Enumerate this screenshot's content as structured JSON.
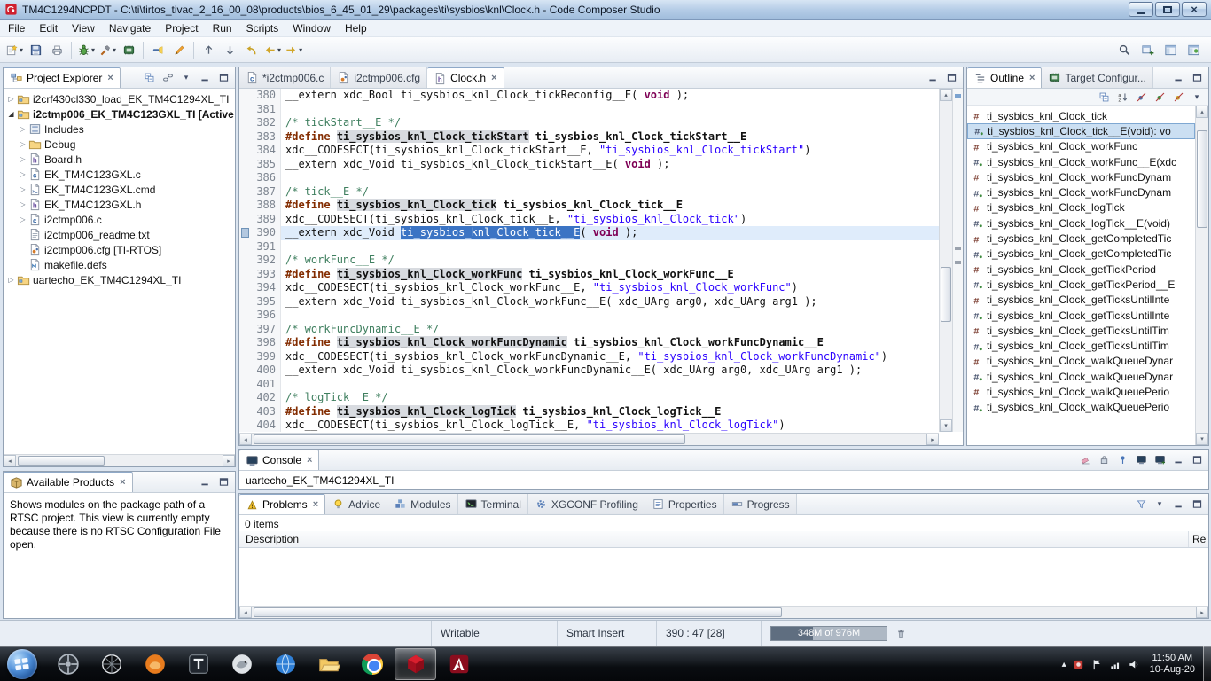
{
  "titlebar": {
    "title": "TM4C1294NCPDT - C:\\ti\\tirtos_tivac_2_16_00_08\\products\\bios_6_45_01_29\\packages\\ti\\sysbios\\knl\\Clock.h - Code Composer Studio",
    "app_icon": "app-ccs"
  },
  "menubar": {
    "items": [
      "File",
      "Edit",
      "View",
      "Navigate",
      "Project",
      "Run",
      "Scripts",
      "Window",
      "Help"
    ]
  },
  "toolbar": {
    "groups": [
      [
        {
          "name": "new-wizard",
          "icon": "new-wizard",
          "dropdown": true
        },
        {
          "name": "save",
          "icon": "save"
        },
        {
          "name": "print",
          "icon": "print"
        }
      ],
      [
        {
          "name": "debug",
          "icon": "debug",
          "dropdown": true
        },
        {
          "name": "build",
          "icon": "build",
          "dropdown": true
        },
        {
          "name": "new-target-config",
          "icon": "target-config"
        }
      ],
      [
        {
          "name": "flash",
          "icon": "flashlight"
        },
        {
          "name": "edit",
          "icon": "pencil"
        }
      ],
      [
        {
          "name": "prev-annotation",
          "icon": "arrow-up"
        },
        {
          "name": "next-annotation",
          "icon": "arrow-down"
        },
        {
          "name": "last-edit-location",
          "icon": "last-edit"
        },
        {
          "name": "back",
          "icon": "nav-back",
          "dropdown": true
        },
        {
          "name": "forward",
          "icon": "nav-forward",
          "dropdown": true
        }
      ]
    ],
    "right": [
      {
        "name": "search",
        "icon": "search"
      },
      {
        "name": "open-perspective",
        "icon": "open-perspective"
      },
      {
        "name": "ccs-edit-perspective",
        "icon": "perspective-edit"
      },
      {
        "name": "ccs-debug-perspective",
        "icon": "perspective-debug"
      }
    ]
  },
  "project_explorer": {
    "tabs": [
      {
        "label": "Project Explorer",
        "icon": "explorer-view",
        "active": true,
        "close": true
      }
    ],
    "toolbar": [
      "collapse-all",
      "link-editor",
      "view-menu",
      "minimize-view",
      "maximize-view"
    ],
    "tree": [
      {
        "label": "i2crf430cl330_load_EK_TM4C1294XL_TI",
        "depth": 0,
        "arrow": "collapsed",
        "icon": "project",
        "bold": false
      },
      {
        "label": "i2ctmp006_EK_TM4C123GXL_TI [Active",
        "depth": 0,
        "arrow": "expanded",
        "icon": "project",
        "bold": true
      },
      {
        "label": "Includes",
        "depth": 1,
        "arrow": "collapsed",
        "icon": "includes",
        "bold": false
      },
      {
        "label": "Debug",
        "depth": 1,
        "arrow": "collapsed",
        "icon": "folder",
        "bold": false
      },
      {
        "label": "Board.h",
        "depth": 1,
        "arrow": "collapsed",
        "icon": "h-file",
        "bold": false
      },
      {
        "label": "EK_TM4C123GXL.c",
        "depth": 1,
        "arrow": "collapsed",
        "icon": "c-file",
        "bold": false
      },
      {
        "label": "EK_TM4C123GXL.cmd",
        "depth": 1,
        "arrow": "collapsed",
        "icon": "cmd-file",
        "bold": false
      },
      {
        "label": "EK_TM4C123GXL.h",
        "depth": 1,
        "arrow": "collapsed",
        "icon": "h-file",
        "bold": false
      },
      {
        "label": "i2ctmp006.c",
        "depth": 1,
        "arrow": "collapsed",
        "icon": "c-file",
        "bold": false
      },
      {
        "label": "i2ctmp006_readme.txt",
        "depth": 1,
        "arrow": "none",
        "icon": "txt-file",
        "bold": false
      },
      {
        "label": "i2ctmp006.cfg [TI-RTOS]",
        "depth": 1,
        "arrow": "none",
        "icon": "cfg-file",
        "bold": false
      },
      {
        "label": "makefile.defs",
        "depth": 1,
        "arrow": "none",
        "icon": "mak-file",
        "bold": false
      },
      {
        "label": "uartecho_EK_TM4C1294XL_TI",
        "depth": 0,
        "arrow": "collapsed",
        "icon": "project",
        "bold": false
      }
    ]
  },
  "available_products": {
    "tabs": [
      {
        "label": "Available Products",
        "icon": "products-view",
        "active": true,
        "close": true
      }
    ],
    "toolbar": [
      "minimize-view",
      "maximize-view"
    ],
    "message": "Shows modules on the package path of a RTSC project. This view is currently empty because there is no RTSC Configuration File open."
  },
  "editor": {
    "tabs": [
      {
        "label": "*i2ctmp006.c",
        "icon": "c-file",
        "active": false,
        "close": false
      },
      {
        "label": "i2ctmp006.cfg",
        "icon": "cfg-file",
        "active": false,
        "close": false
      },
      {
        "label": "Clock.h",
        "icon": "h-file",
        "active": true,
        "close": true
      }
    ],
    "toolbar": [
      "minimize-view",
      "maximize-view"
    ],
    "lines": [
      {
        "n": 380,
        "t": [
          [
            "p",
            "__extern xdc_Bool ti_sysbios_knl_Clock_tickReconfig__E( "
          ],
          [
            "k",
            "void"
          ],
          [
            "p",
            " );"
          ]
        ]
      },
      {
        "n": 381,
        "t": []
      },
      {
        "n": 382,
        "t": [
          [
            "c",
            "/* tickStart__E */"
          ]
        ]
      },
      {
        "n": 383,
        "t": [
          [
            "d",
            "#define"
          ],
          [
            "b",
            " "
          ],
          [
            "m",
            "ti_sysbios_knl_Clock_tickStart"
          ],
          [
            "b",
            " ti_sysbios_knl_Clock_tickStart__E"
          ]
        ]
      },
      {
        "n": 384,
        "t": [
          [
            "p",
            "xdc__CODESECT(ti_sysbios_knl_Clock_tickStart__E, "
          ],
          [
            "s",
            "\"ti_sysbios_knl_Clock_tickStart\""
          ],
          [
            "p",
            ")"
          ]
        ]
      },
      {
        "n": 385,
        "t": [
          [
            "p",
            "__extern xdc_Void ti_sysbios_knl_Clock_tickStart__E( "
          ],
          [
            "k",
            "void"
          ],
          [
            "p",
            " );"
          ]
        ]
      },
      {
        "n": 386,
        "t": []
      },
      {
        "n": 387,
        "t": [
          [
            "c",
            "/* tick__E */"
          ]
        ]
      },
      {
        "n": 388,
        "t": [
          [
            "d",
            "#define"
          ],
          [
            "b",
            " "
          ],
          [
            "m",
            "ti_sysbios_knl_Clock_tick"
          ],
          [
            "b",
            " ti_sysbios_knl_Clock_tick__E"
          ]
        ]
      },
      {
        "n": 389,
        "t": [
          [
            "p",
            "xdc__CODESECT(ti_sysbios_knl_Clock_tick__E, "
          ],
          [
            "s",
            "\"ti_sysbios_knl_Clock_tick\""
          ],
          [
            "p",
            ")"
          ]
        ]
      },
      {
        "n": 390,
        "cur": true,
        "t": [
          [
            "p",
            "__extern xdc_Void "
          ],
          [
            "x",
            "ti_sysbios_knl_Clock_tick__E"
          ],
          [
            "p",
            "( "
          ],
          [
            "k",
            "void"
          ],
          [
            "p",
            " );"
          ]
        ]
      },
      {
        "n": 391,
        "t": []
      },
      {
        "n": 392,
        "t": [
          [
            "c",
            "/* workFunc__E */"
          ]
        ]
      },
      {
        "n": 393,
        "t": [
          [
            "d",
            "#define"
          ],
          [
            "b",
            " "
          ],
          [
            "m",
            "ti_sysbios_knl_Clock_workFunc"
          ],
          [
            "b",
            " ti_sysbios_knl_Clock_workFunc__E"
          ]
        ]
      },
      {
        "n": 394,
        "t": [
          [
            "p",
            "xdc__CODESECT(ti_sysbios_knl_Clock_workFunc__E, "
          ],
          [
            "s",
            "\"ti_sysbios_knl_Clock_workFunc\""
          ],
          [
            "p",
            ")"
          ]
        ]
      },
      {
        "n": 395,
        "t": [
          [
            "p",
            "__extern xdc_Void ti_sysbios_knl_Clock_workFunc__E( xdc_UArg arg0, xdc_UArg arg1 );"
          ]
        ]
      },
      {
        "n": 396,
        "t": []
      },
      {
        "n": 397,
        "t": [
          [
            "c",
            "/* workFuncDynamic__E */"
          ]
        ]
      },
      {
        "n": 398,
        "t": [
          [
            "d",
            "#define"
          ],
          [
            "b",
            " "
          ],
          [
            "m",
            "ti_sysbios_knl_Clock_workFuncDynamic"
          ],
          [
            "b",
            " ti_sysbios_knl_Clock_workFuncDynamic__E"
          ]
        ]
      },
      {
        "n": 399,
        "t": [
          [
            "p",
            "xdc__CODESECT(ti_sysbios_knl_Clock_workFuncDynamic__E, "
          ],
          [
            "s",
            "\"ti_sysbios_knl_Clock_workFuncDynamic\""
          ],
          [
            "p",
            ")"
          ]
        ]
      },
      {
        "n": 400,
        "t": [
          [
            "p",
            "__extern xdc_Void ti_sysbios_knl_Clock_workFuncDynamic__E( xdc_UArg arg0, xdc_UArg arg1 );"
          ]
        ]
      },
      {
        "n": 401,
        "t": []
      },
      {
        "n": 402,
        "t": [
          [
            "c",
            "/* logTick__E */"
          ]
        ]
      },
      {
        "n": 403,
        "t": [
          [
            "d",
            "#define"
          ],
          [
            "b",
            " "
          ],
          [
            "m",
            "ti_sysbios_knl_Clock_logTick"
          ],
          [
            "b",
            " ti_sysbios_knl_Clock_logTick__E"
          ]
        ]
      },
      {
        "n": 404,
        "t": [
          [
            "p",
            "xdc__CODESECT(ti_sysbios_knl_Clock_logTick__E, "
          ],
          [
            "s",
            "\"ti_sysbios_knl_Clock_logTick\""
          ],
          [
            "p",
            ")"
          ]
        ]
      }
    ]
  },
  "outline": {
    "tabs": [
      {
        "label": "Outline",
        "icon": "outline-view",
        "active": true,
        "close": true
      },
      {
        "label": "Target Configur...",
        "icon": "target-config",
        "active": false,
        "close": false
      }
    ],
    "header_buttons": [
      "minimize-view",
      "maximize-view"
    ],
    "toolbar": [
      "collapse-all",
      "sort-alpha",
      "hide-fields",
      "hide-static",
      "hide-nonpublic",
      "view-menu"
    ],
    "items": [
      {
        "label": "ti_sysbios_knl_Clock_tick",
        "icon": "define-symbol",
        "selected": false
      },
      {
        "label": "ti_sysbios_knl_Clock_tick__E(void): vo",
        "icon": "function-symbol",
        "selected": true
      },
      {
        "label": "ti_sysbios_knl_Clock_workFunc",
        "icon": "define-symbol",
        "selected": false
      },
      {
        "label": "ti_sysbios_knl_Clock_workFunc__E(xdc",
        "icon": "function-symbol",
        "selected": false
      },
      {
        "label": "ti_sysbios_knl_Clock_workFuncDynam",
        "icon": "define-symbol",
        "selected": false
      },
      {
        "label": "ti_sysbios_knl_Clock_workFuncDynam",
        "icon": "function-symbol",
        "selected": false
      },
      {
        "label": "ti_sysbios_knl_Clock_logTick",
        "icon": "define-symbol",
        "selected": false
      },
      {
        "label": "ti_sysbios_knl_Clock_logTick__E(void)",
        "icon": "function-symbol",
        "selected": false
      },
      {
        "label": "ti_sysbios_knl_Clock_getCompletedTic",
        "icon": "define-symbol",
        "selected": false
      },
      {
        "label": "ti_sysbios_knl_Clock_getCompletedTic",
        "icon": "function-symbol",
        "selected": false
      },
      {
        "label": "ti_sysbios_knl_Clock_getTickPeriod",
        "icon": "define-symbol",
        "selected": false
      },
      {
        "label": "ti_sysbios_knl_Clock_getTickPeriod__E",
        "icon": "function-symbol",
        "selected": false
      },
      {
        "label": "ti_sysbios_knl_Clock_getTicksUntilInte",
        "icon": "define-symbol",
        "selected": false
      },
      {
        "label": "ti_sysbios_knl_Clock_getTicksUntilInte",
        "icon": "function-symbol",
        "selected": false
      },
      {
        "label": "ti_sysbios_knl_Clock_getTicksUntilTim",
        "icon": "define-symbol",
        "selected": false
      },
      {
        "label": "ti_sysbios_knl_Clock_getTicksUntilTim",
        "icon": "function-symbol",
        "selected": false
      },
      {
        "label": "ti_sysbios_knl_Clock_walkQueueDynar",
        "icon": "define-symbol",
        "selected": false
      },
      {
        "label": "ti_sysbios_knl_Clock_walkQueueDynar",
        "icon": "function-symbol",
        "selected": false
      },
      {
        "label": "ti_sysbios_knl_Clock_walkQueuePerio",
        "icon": "define-symbol",
        "selected": false
      },
      {
        "label": "ti_sysbios_knl_Clock_walkQueuePerio",
        "icon": "function-symbol",
        "selected": false
      }
    ]
  },
  "console": {
    "tabs": [
      {
        "label": "Console",
        "icon": "console-view",
        "active": true,
        "close": true
      }
    ],
    "toolbar": [
      "clear-console",
      "scroll-lock",
      "pin-console",
      "display-console",
      "open-console",
      "minimize-view",
      "maximize-view"
    ],
    "text": "uartecho_EK_TM4C1294XL_TI"
  },
  "problems": {
    "tabs": [
      {
        "label": "Problems",
        "icon": "problems-view",
        "active": true,
        "close": true
      },
      {
        "label": "Advice",
        "icon": "advice-bulb",
        "active": false,
        "close": false
      },
      {
        "label": "Modules",
        "icon": "modules",
        "active": false,
        "close": false
      },
      {
        "label": "Terminal",
        "icon": "terminal",
        "active": false,
        "close": false
      },
      {
        "label": "XGCONF Profiling",
        "icon": "xgconf-gear",
        "active": false,
        "close": false
      },
      {
        "label": "Properties",
        "icon": "properties",
        "active": false,
        "close": false
      },
      {
        "label": "Progress",
        "icon": "progress",
        "active": false,
        "close": false
      }
    ],
    "toolbar": [
      "filter-funnel",
      "view-menu",
      "minimize-view",
      "maximize-view"
    ],
    "items_count": "0 items",
    "columns": [
      "Description",
      "Re"
    ]
  },
  "statusbar": {
    "writable": "Writable",
    "input_mode": "Smart Insert",
    "position": "390 : 47 [28]",
    "heap": "348M of 976M",
    "heap_percent": 36,
    "gc_icon": "trash"
  },
  "taskbar": {
    "apps": [
      {
        "name": "compass-app",
        "icon": "tb-compass",
        "active": false
      },
      {
        "name": "crosshair-app",
        "icon": "tb-crosshair",
        "active": false
      },
      {
        "name": "orange-app",
        "icon": "tb-orange",
        "active": false
      },
      {
        "name": "t-app",
        "icon": "tb-tapp",
        "active": false
      },
      {
        "name": "bird-app",
        "icon": "tb-bird",
        "active": false
      },
      {
        "name": "browser-app",
        "icon": "tb-globe",
        "active": false
      },
      {
        "name": "explorer-app",
        "icon": "tb-folder",
        "active": false
      },
      {
        "name": "chrome-app",
        "icon": "tb-chrome",
        "active": false
      },
      {
        "name": "ccs-app",
        "icon": "tb-ccs",
        "active": true
      },
      {
        "name": "adobe-reader-app",
        "icon": "tb-adobe",
        "active": false
      }
    ],
    "tray_icons": [
      "tray-chevron",
      "tray-app",
      "tray-flag",
      "tray-network",
      "tray-volume"
    ],
    "clock_time": "11:50 AM",
    "clock_date": "10-Aug-20"
  }
}
